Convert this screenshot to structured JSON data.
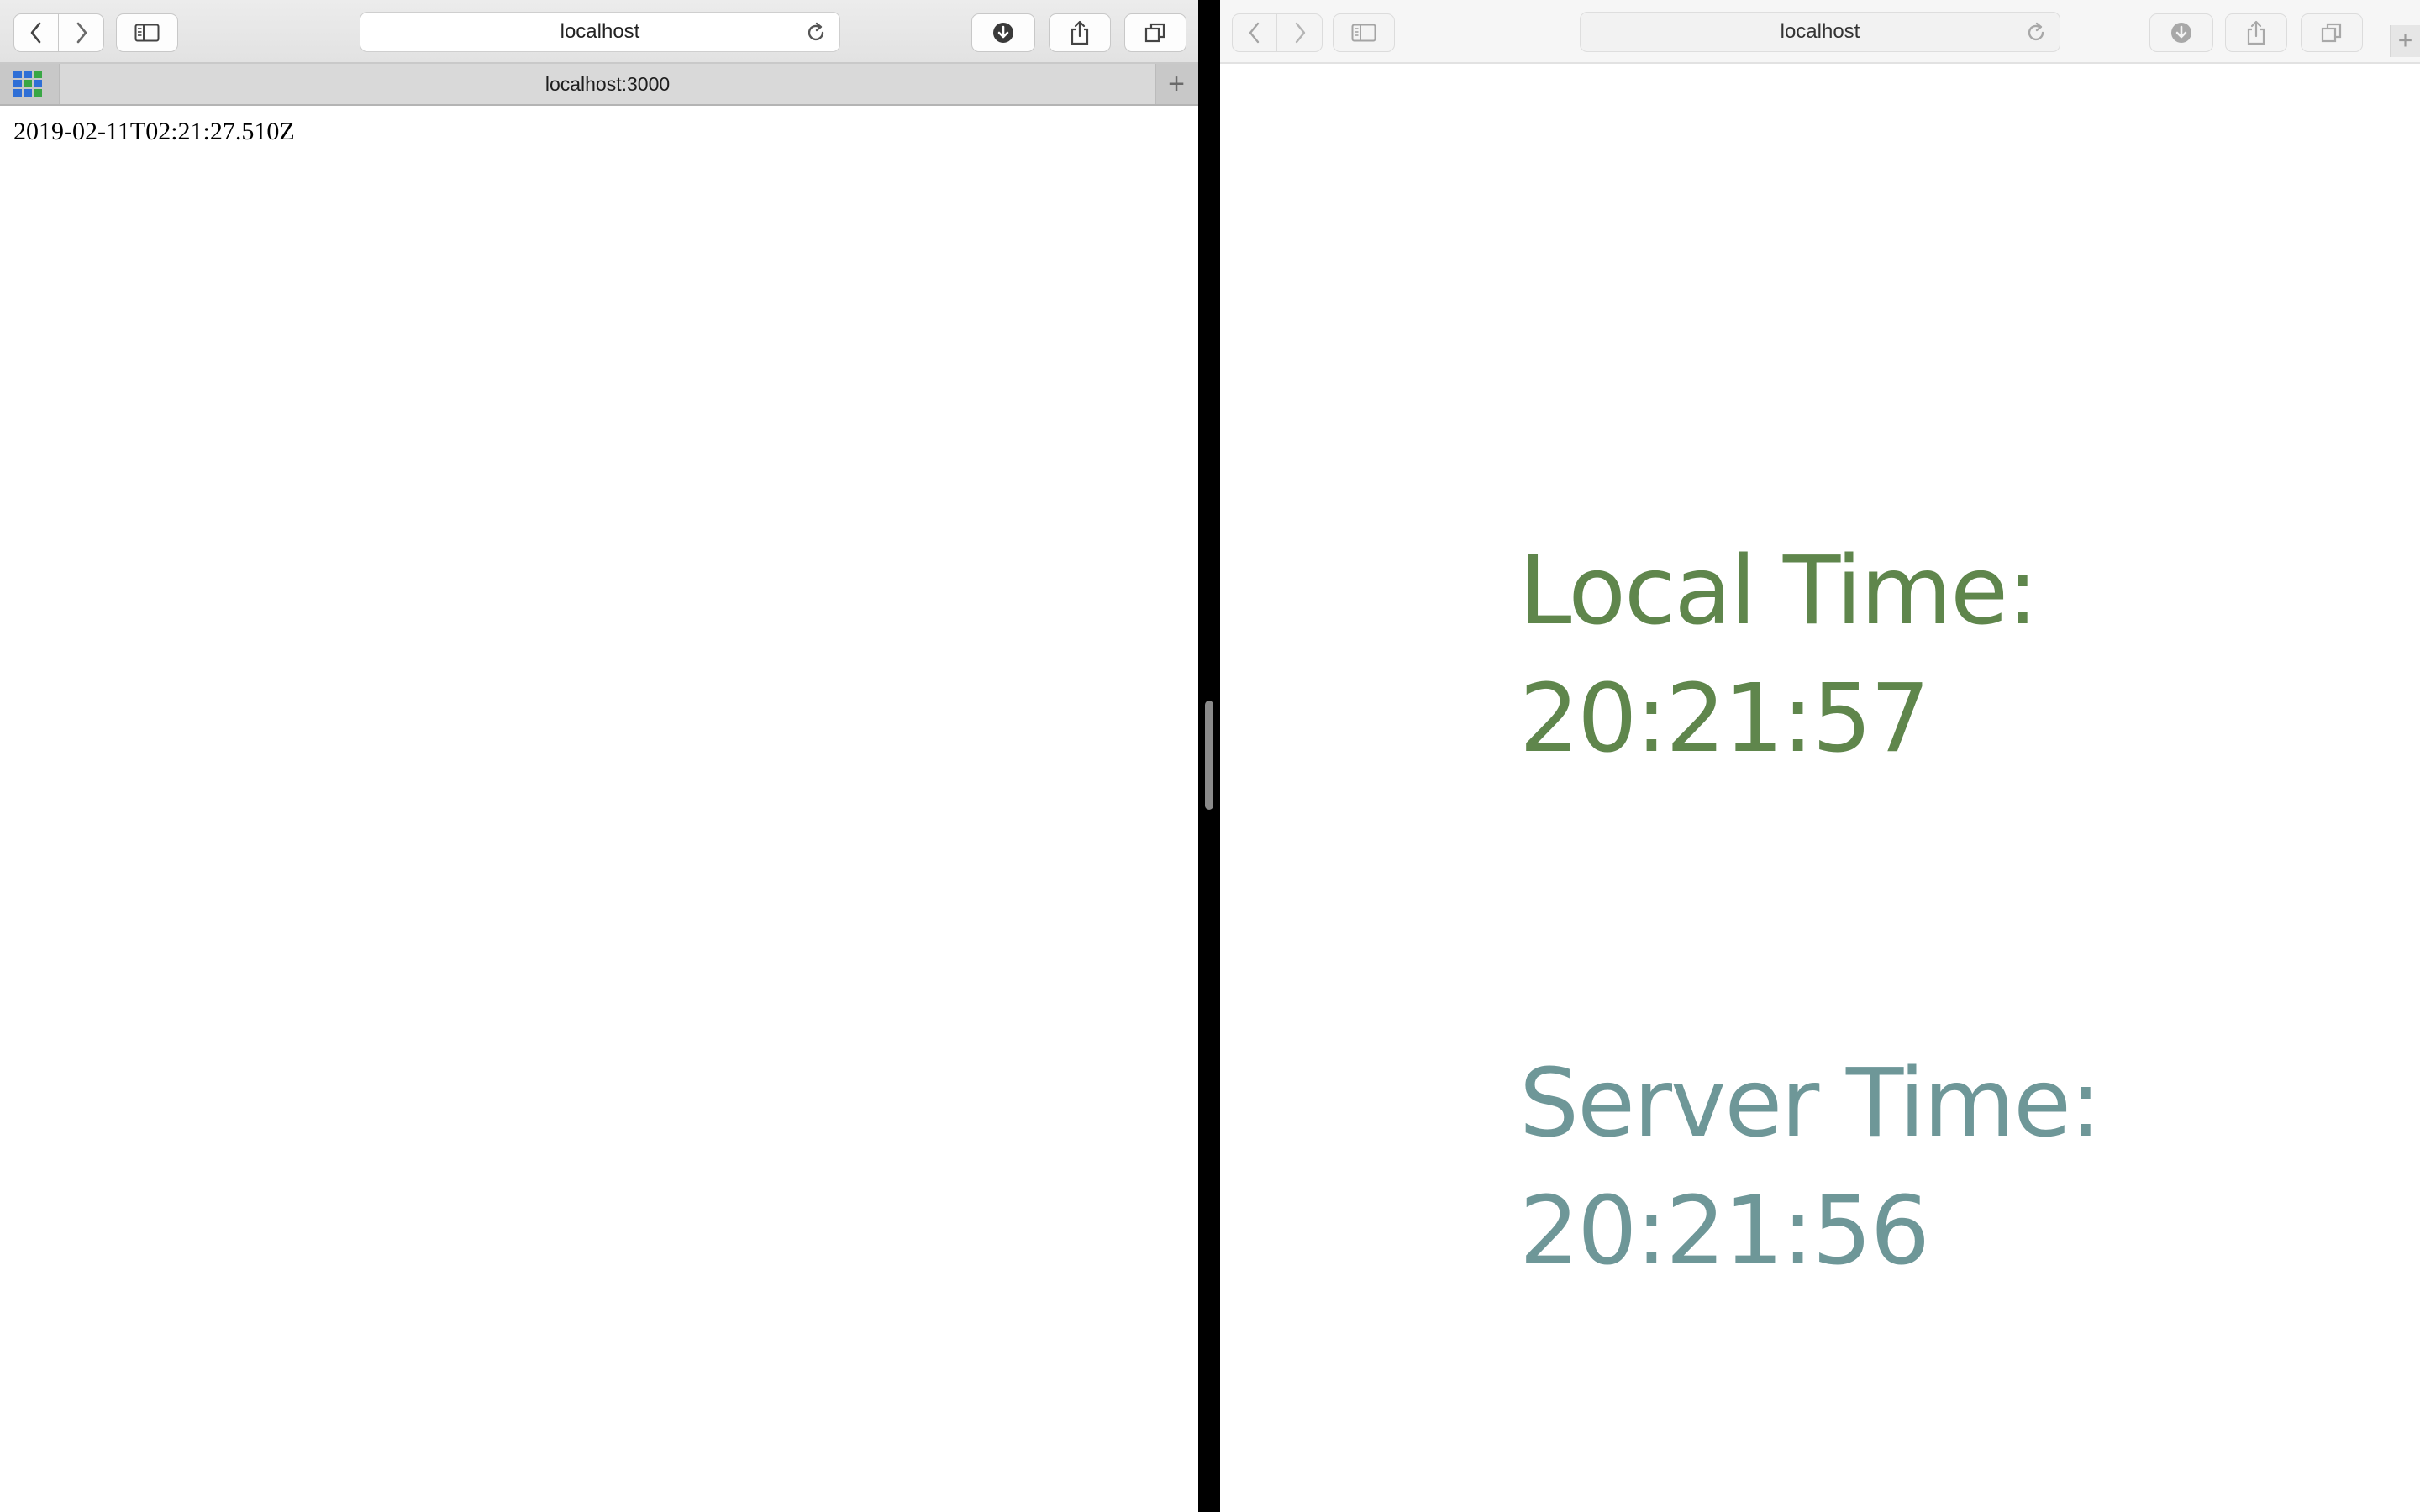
{
  "colors": {
    "local_time": "#5f864c",
    "server_time": "#6e9798"
  },
  "left_window": {
    "address": "localhost",
    "tab": {
      "title": "localhost:3000"
    },
    "page_text": "2019-02-11T02:21:27.510Z"
  },
  "right_window": {
    "address": "localhost",
    "local_time": {
      "label": "Local Time:",
      "value": "20:21:57"
    },
    "server_time": {
      "label": "Server Time:",
      "value": "20:21:56"
    }
  },
  "icons": {
    "back": "chevron-left-icon",
    "forward": "chevron-right-icon",
    "sidebar": "sidebar-icon",
    "reload": "reload-icon",
    "downloads": "download-icon",
    "share": "share-icon",
    "tabs": "tab-overview-icon",
    "new_tab": "plus-icon"
  }
}
